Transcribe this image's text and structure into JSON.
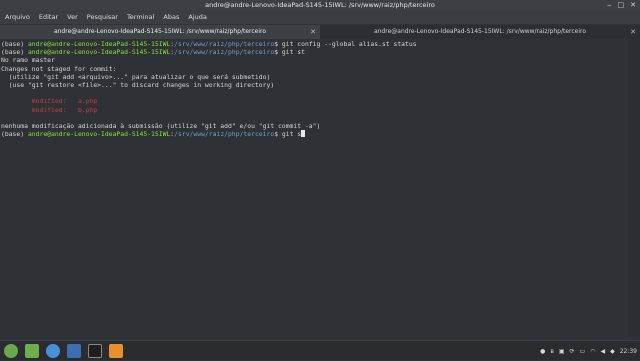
{
  "window": {
    "title": "andre@andre-Lenovo-IdeaPad-S145-15IWL: /srv/www/raiz/php/terceiro"
  },
  "menu": [
    "Arquivo",
    "Editar",
    "Ver",
    "Pesquisar",
    "Terminal",
    "Abas",
    "Ajuda"
  ],
  "tabs": [
    {
      "label": "andre@andre-Lenovo-IdeaPad-S145-15IWL: /srv/www/raiz/php/terceiro"
    },
    {
      "label": "andre@andre-Lenovo-IdeaPad-S145-15IWL: /srv/www/raiz/php/terceiro"
    }
  ],
  "terminal": {
    "prompt_env": "(base) ",
    "prompt_user": "andre@andre-Lenovo-IdeaPad-S145-15IWL",
    "prompt_sep": ":",
    "prompt_path": "/srv/www/raiz/php/terceiro",
    "prompt_end": "$ ",
    "cmd1": "git config --global alias.st status",
    "cmd2": "git st",
    "out1": "No ramo master",
    "out2": "Changes not staged for commit:",
    "out3": "  (utilize \"git add <arquivo>...\" para atualizar o que será submetido)",
    "out4": "  (use \"git restore <file>...\" to discard changes in working directory)",
    "mod1": "        modified:   a.php",
    "mod2": "        modified:   b.php",
    "out5": "nenhuma modificação adicionada à submissão (utilize \"git add\" e/ou \"git commit -a\")",
    "cmd3": "git s"
  },
  "taskbar": {
    "clock": "22:39",
    "icons": [
      "mint-menu-icon",
      "files-icon",
      "firefox-icon",
      "terminal-icon",
      "software-icon"
    ]
  },
  "colors": {
    "prompt_user": "#8ae234",
    "prompt_path": "#729fcf",
    "modified": "#cc3c3c"
  }
}
